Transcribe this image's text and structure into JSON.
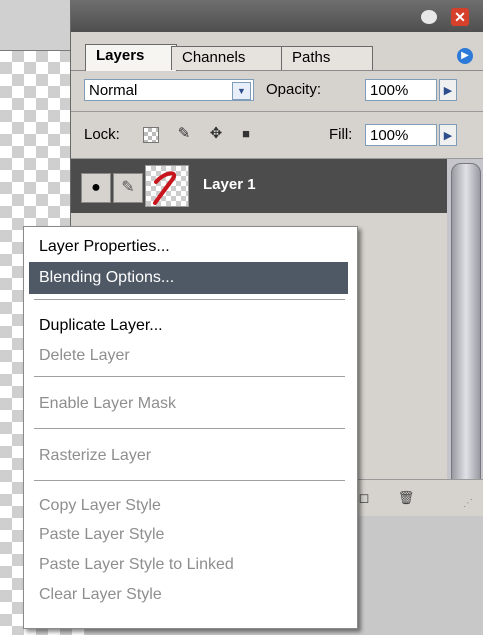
{
  "palette": {
    "tabs": [
      {
        "label": "Layers"
      },
      {
        "label": "Channels"
      },
      {
        "label": "Paths"
      }
    ],
    "blend_mode": "Normal",
    "opacity_label": "Opacity:",
    "opacity_value": "100%",
    "lock_label": "Lock:",
    "fill_label": "Fill:",
    "fill_value": "100%",
    "layers": [
      {
        "name": "Layer 1",
        "visible": true,
        "selected": true
      }
    ]
  },
  "context_menu": {
    "items": [
      {
        "label": "Layer Properties...",
        "enabled": true
      },
      {
        "label": "Blending Options...",
        "enabled": true,
        "highlighted": true
      },
      {
        "label": "Duplicate Layer...",
        "enabled": true
      },
      {
        "label": "Delete Layer",
        "enabled": false
      },
      {
        "label": "Enable Layer Mask",
        "enabled": false
      },
      {
        "label": "Rasterize Layer",
        "enabled": false
      },
      {
        "label": "Copy Layer Style",
        "enabled": false
      },
      {
        "label": "Paste Layer Style",
        "enabled": false
      },
      {
        "label": "Paste Layer Style to Linked",
        "enabled": false
      },
      {
        "label": "Clear Layer Style",
        "enabled": false
      }
    ]
  },
  "colors": {
    "menu_highlight": "#4f5965",
    "layer_row_selected": "#4c4c4c",
    "close_button": "#d5402b",
    "palette_menu_button": "#2d7ad8"
  }
}
